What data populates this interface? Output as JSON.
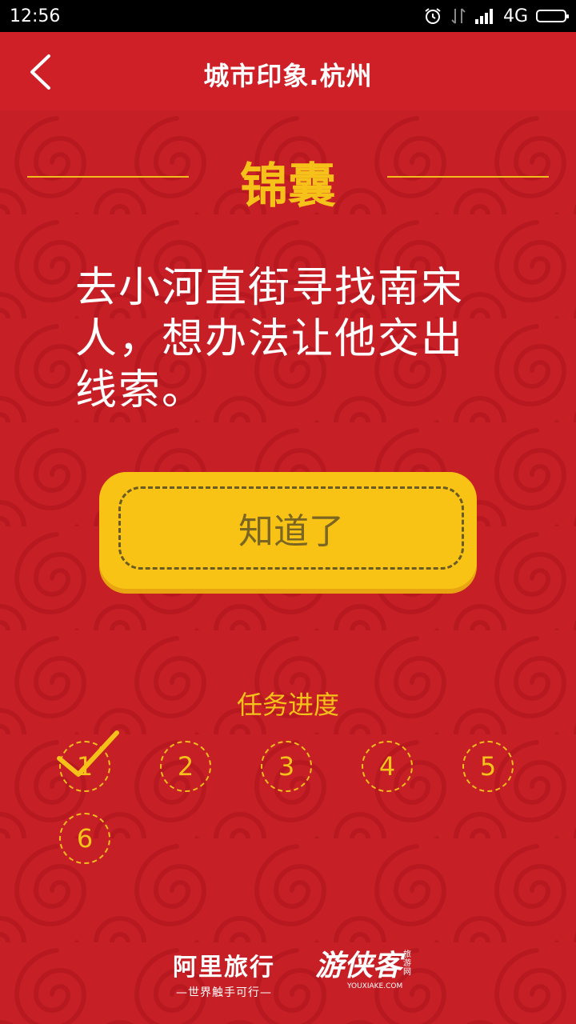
{
  "status_bar": {
    "time": "12:56",
    "network": "4G",
    "icons": [
      "alarm-icon",
      "data-arrows-icon",
      "signal-icon",
      "battery-icon"
    ]
  },
  "nav": {
    "back_icon": "chevron-left-icon",
    "title": "城市印象.杭州"
  },
  "card": {
    "heading": "锦囊",
    "task_text": "去小河直街寻找南宋人，想办法让他交出线索。",
    "confirm_button": "知道了"
  },
  "progress": {
    "label": "任务进度",
    "steps": [
      {
        "number": "1",
        "completed": true
      },
      {
        "number": "2",
        "completed": false
      },
      {
        "number": "3",
        "completed": false
      },
      {
        "number": "4",
        "completed": false
      },
      {
        "number": "5",
        "completed": false
      },
      {
        "number": "6",
        "completed": false
      }
    ]
  },
  "footer": {
    "alitrip_title": "阿里旅行",
    "alitrip_slogan": "—世界触手可行—",
    "youxiake_title": "游侠客",
    "youxiake_domain": "YOUXIAKE.COM",
    "youxiake_tag": "旅游网"
  },
  "colors": {
    "background_red": "#c71f26",
    "accent_yellow": "#f6c21a",
    "button_yellow": "#f8c315",
    "status_bar": "#000000"
  }
}
